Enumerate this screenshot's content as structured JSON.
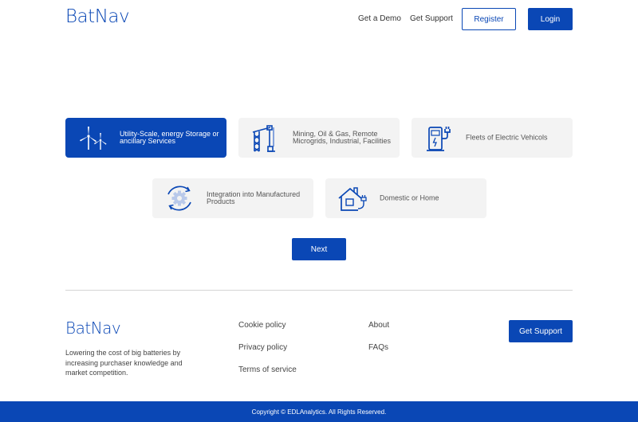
{
  "brand": {
    "part1": "Bat",
    "part2": "Nav"
  },
  "header": {
    "nav": [
      "Get a Demo",
      "Get Support"
    ],
    "register_label": "Register",
    "login_label": "Login"
  },
  "options": [
    {
      "label": "Utility-Scale, energy Storage or ancillary Services",
      "icon": "wind-turbine-icon",
      "selected": true
    },
    {
      "label": "Mining, Oil & Gas, Remote Microgrids, Industrial, Facilities",
      "icon": "oil-rig-icon",
      "selected": false
    },
    {
      "label": "Fleets of Electric Vehicols",
      "icon": "ev-charger-icon",
      "selected": false
    },
    {
      "label": "Integration into Manufactured Products",
      "icon": "gear-cycle-icon",
      "selected": false
    },
    {
      "label": "Domestic or Home",
      "icon": "house-plug-icon",
      "selected": false
    }
  ],
  "next_label": "Next",
  "footer": {
    "tagline": "Lowering the cost of big batteries by increasing purchaser knowledge and market competition.",
    "links_col1": [
      "Cookie policy",
      "Privacy policy",
      "Terms of service"
    ],
    "links_col2": [
      "About",
      "FAQs"
    ],
    "support_label": "Get Support",
    "copyright": "Copyright © EDLAnalytics. All Rights Reserved."
  },
  "colors": {
    "brand": "#0a47b5",
    "card_bg": "#f3f3f3"
  }
}
